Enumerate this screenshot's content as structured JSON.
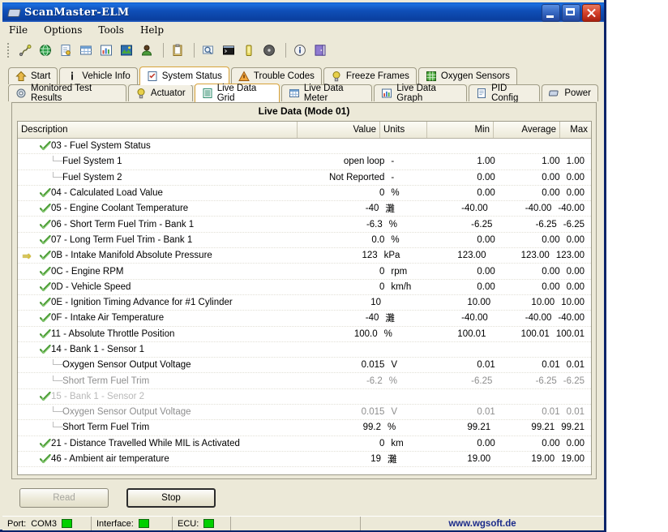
{
  "window": {
    "title": "ScanMaster-ELM",
    "icon": "chip-icon",
    "controls": [
      {
        "name": "minimize-button",
        "glyph": "minimize-icon"
      },
      {
        "name": "maximize-button",
        "glyph": "maximize-icon"
      },
      {
        "name": "close-button",
        "glyph": "close-icon"
      }
    ]
  },
  "menu": [
    "File",
    "Options",
    "Tools",
    "Help"
  ],
  "toolbar": {
    "groups": [
      [
        "connect-plug-icon",
        "globe-icon",
        "report-icon",
        "table-icon",
        "chart-icon",
        "image-icon",
        "user-icon"
      ],
      [
        "clipboard-icon"
      ],
      [
        "search-monitor-icon",
        "terminal-icon",
        "battery-icon",
        "disc-icon"
      ],
      [
        "info-icon",
        "exit-icon"
      ]
    ]
  },
  "tabs": {
    "row1": [
      {
        "label": "Start",
        "icon": "home-icon",
        "selected": false
      },
      {
        "label": "Vehicle Info",
        "icon": "info-i-icon",
        "selected": false
      },
      {
        "label": "System Status",
        "icon": "checklist-icon",
        "selected": true
      },
      {
        "label": "Trouble Codes",
        "icon": "warning-icon",
        "selected": false
      },
      {
        "label": "Freeze Frames",
        "icon": "bulb-icon",
        "selected": false
      },
      {
        "label": "Oxygen Sensors",
        "icon": "grid-green-icon",
        "selected": false
      }
    ],
    "row2": [
      {
        "label": "Monitored Test Results",
        "icon": "gear-icon",
        "selected": false
      },
      {
        "label": "Actuator",
        "icon": "bulb-icon",
        "selected": false
      },
      {
        "label": "Live Data Grid",
        "icon": "list-icon",
        "selected": true
      },
      {
        "label": "Live Data Meter",
        "icon": "table-icon",
        "selected": false
      },
      {
        "label": "Live Data Graph",
        "icon": "chart-icon",
        "selected": false
      },
      {
        "label": "PID Config",
        "icon": "config-icon",
        "selected": false
      },
      {
        "label": "Power",
        "icon": "chip-icon",
        "selected": false
      }
    ]
  },
  "panel": {
    "title": "Live Data (Mode 01)",
    "columns": [
      "Description",
      "Value",
      "Units",
      "Min",
      "Average",
      "Max"
    ],
    "rows": [
      {
        "mark": "",
        "state": "check",
        "indent": 0,
        "desc": "03 - Fuel System Status",
        "value": "",
        "units": "",
        "min": "",
        "avg": "",
        "max": "",
        "fade": ""
      },
      {
        "mark": "",
        "state": "child",
        "indent": 1,
        "desc": "Fuel System 1",
        "value": "open loop",
        "units": "-",
        "min": "1.00",
        "avg": "1.00",
        "max": "1.00",
        "fade": ""
      },
      {
        "mark": "",
        "state": "child",
        "indent": 1,
        "desc": "Fuel System 2",
        "value": "Not Reported",
        "units": "-",
        "min": "0.00",
        "avg": "0.00",
        "max": "0.00",
        "fade": ""
      },
      {
        "mark": "",
        "state": "check",
        "indent": 0,
        "desc": "04 - Calculated Load Value",
        "value": "0",
        "units": "%",
        "min": "0.00",
        "avg": "0.00",
        "max": "0.00",
        "fade": ""
      },
      {
        "mark": "",
        "state": "check",
        "indent": 0,
        "desc": "05 - Engine Coolant Temperature",
        "value": "-40",
        "units": "灘",
        "min": "-40.00",
        "avg": "-40.00",
        "max": "-40.00",
        "fade": ""
      },
      {
        "mark": "",
        "state": "check",
        "indent": 0,
        "desc": "06 - Short Term Fuel Trim - Bank 1",
        "value": "-6.3",
        "units": "%",
        "min": "-6.25",
        "avg": "-6.25",
        "max": "-6.25",
        "fade": ""
      },
      {
        "mark": "",
        "state": "check",
        "indent": 0,
        "desc": "07 - Long Term Fuel Trim - Bank 1",
        "value": "0.0",
        "units": "%",
        "min": "0.00",
        "avg": "0.00",
        "max": "0.00",
        "fade": ""
      },
      {
        "mark": "arrow",
        "state": "check",
        "indent": 0,
        "desc": "0B - Intake Manifold Absolute Pressure",
        "value": "123",
        "units": "kPa",
        "min": "123.00",
        "avg": "123.00",
        "max": "123.00",
        "fade": ""
      },
      {
        "mark": "",
        "state": "check",
        "indent": 0,
        "desc": "0C - Engine RPM",
        "value": "0",
        "units": "rpm",
        "min": "0.00",
        "avg": "0.00",
        "max": "0.00",
        "fade": ""
      },
      {
        "mark": "",
        "state": "check",
        "indent": 0,
        "desc": "0D - Vehicle Speed",
        "value": "0",
        "units": "km/h",
        "min": "0.00",
        "avg": "0.00",
        "max": "0.00",
        "fade": ""
      },
      {
        "mark": "",
        "state": "check",
        "indent": 0,
        "desc": "0E - Ignition Timing Advance for #1 Cylinder",
        "value": "10",
        "units": "",
        "min": "10.00",
        "avg": "10.00",
        "max": "10.00",
        "fade": ""
      },
      {
        "mark": "",
        "state": "check",
        "indent": 0,
        "desc": "0F - Intake Air Temperature",
        "value": "-40",
        "units": "灘",
        "min": "-40.00",
        "avg": "-40.00",
        "max": "-40.00",
        "fade": ""
      },
      {
        "mark": "",
        "state": "check",
        "indent": 0,
        "desc": "11 - Absolute Throttle Position",
        "value": "100.0",
        "units": "%",
        "min": "100.01",
        "avg": "100.01",
        "max": "100.01",
        "fade": ""
      },
      {
        "mark": "",
        "state": "check",
        "indent": 0,
        "desc": "14 - Bank 1 - Sensor 1",
        "value": "",
        "units": "",
        "min": "",
        "avg": "",
        "max": "",
        "fade": ""
      },
      {
        "mark": "",
        "state": "child",
        "indent": 1,
        "desc": "Oxygen Sensor Output Voltage",
        "value": "0.015",
        "units": "V",
        "min": "0.01",
        "avg": "0.01",
        "max": "0.01",
        "fade": ""
      },
      {
        "mark": "",
        "state": "child",
        "indent": 1,
        "desc": "Short Term Fuel Trim",
        "value": "-6.2",
        "units": "%",
        "min": "-6.25",
        "avg": "-6.25",
        "max": "-6.25",
        "fade": "faded2"
      },
      {
        "mark": "",
        "state": "check",
        "indent": 0,
        "desc": "15 - Bank 1 - Sensor 2",
        "value": "",
        "units": "",
        "min": "",
        "avg": "",
        "max": "",
        "fade": "faded"
      },
      {
        "mark": "",
        "state": "child",
        "indent": 1,
        "desc": "Oxygen Sensor Output Voltage",
        "value": "0.015",
        "units": "V",
        "min": "0.01",
        "avg": "0.01",
        "max": "0.01",
        "fade": "faded2"
      },
      {
        "mark": "",
        "state": "child",
        "indent": 1,
        "desc": "Short Term Fuel Trim",
        "value": "99.2",
        "units": "%",
        "min": "99.21",
        "avg": "99.21",
        "max": "99.21",
        "fade": ""
      },
      {
        "mark": "",
        "state": "check",
        "indent": 0,
        "desc": "21 - Distance Travelled While MIL is Activated",
        "value": "0",
        "units": "km",
        "min": "0.00",
        "avg": "0.00",
        "max": "0.00",
        "fade": ""
      },
      {
        "mark": "",
        "state": "check",
        "indent": 0,
        "desc": "46 - Ambient air temperature",
        "value": "19",
        "units": "灘",
        "min": "19.00",
        "avg": "19.00",
        "max": "19.00",
        "fade": ""
      }
    ]
  },
  "buttons": {
    "read": "Read",
    "stop": "Stop"
  },
  "status": {
    "port_label": "Port:",
    "port_value": "COM3",
    "interface_label": "Interface:",
    "ecu_label": "ECU:",
    "website": "www.wgsoft.de",
    "led_color": "#00d000"
  }
}
